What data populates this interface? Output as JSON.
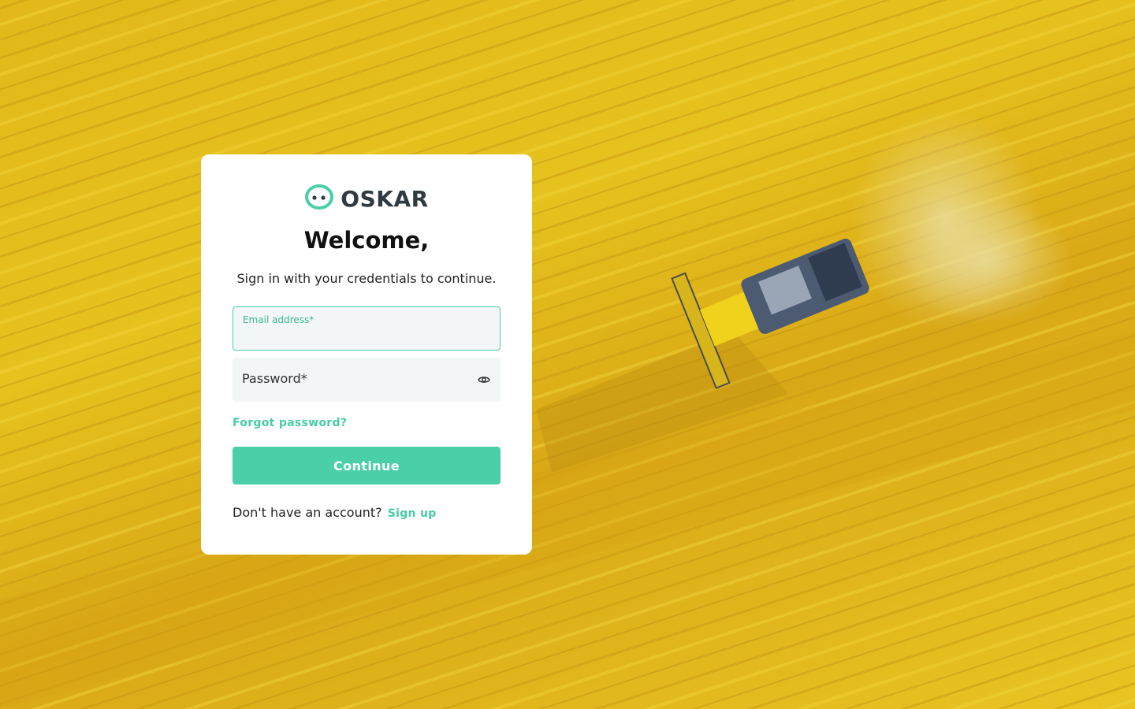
{
  "brand": {
    "name": "OSKAR",
    "accent_color": "#4ACFA8",
    "logo_icon": "oskar-face-logo"
  },
  "background": {
    "description_icon": "wheat-field-harvester-photo"
  },
  "login": {
    "heading": "Welcome,",
    "subtitle": "Sign in with your credentials to continue.",
    "email_label": "Email address*",
    "email_value": "",
    "password_placeholder": "Password*",
    "password_toggle_icon": "eye-icon",
    "forgot_password": "Forgot password?",
    "continue_label": "Continue",
    "no_account_text": "Don't have an account?",
    "signup_label": "Sign up"
  }
}
